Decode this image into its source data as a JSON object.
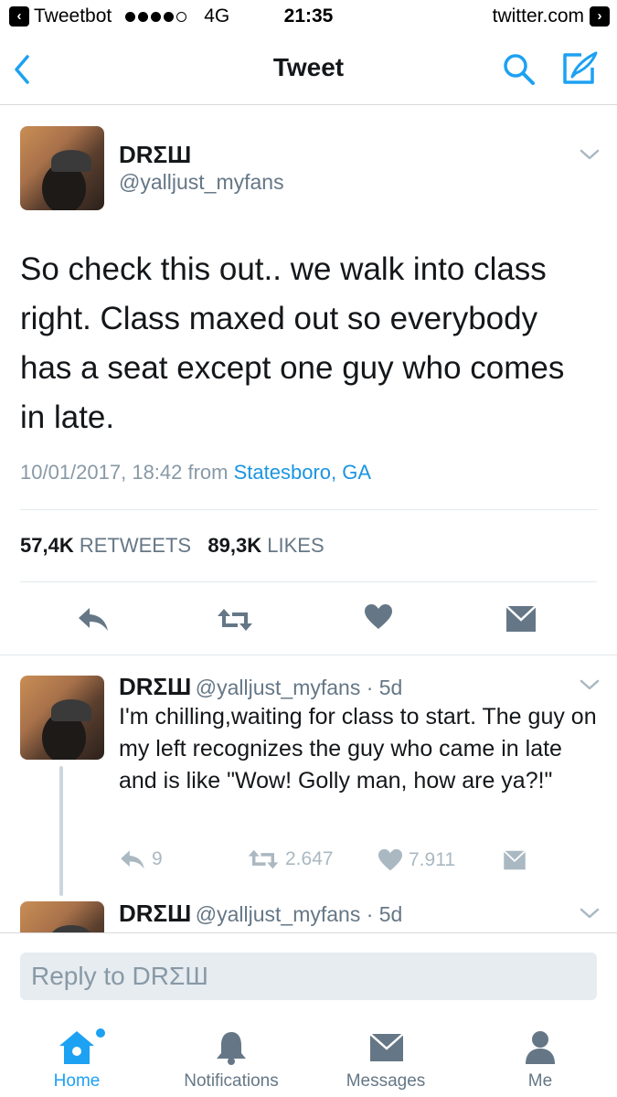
{
  "status_bar": {
    "back_app": "Tweetbot",
    "network": "4G",
    "time": "21:35",
    "url": "twitter.com"
  },
  "nav": {
    "title": "Tweet",
    "icons": [
      "back-chevron-icon",
      "search-icon",
      "compose-icon"
    ]
  },
  "tweet": {
    "display_name": "DRΣШ",
    "handle": "@yalljust_myfans",
    "text": "So check this out.. we walk into class right. Class maxed out so everybody has a seat except one guy who comes in late.",
    "timestamp": "10/01/2017, 18:42 from ",
    "location": "Statesboro, GA",
    "retweets_count": "57,4K",
    "retweets_label": "RETWEETS",
    "likes_count": "89,3K",
    "likes_label": "LIKES"
  },
  "replies": [
    {
      "display_name": "DRΣШ",
      "handle_time": "@yalljust_myfans · 5d",
      "text": "I'm chilling,waiting for class to start. The guy on my left recognizes the guy who came in late and is like \"Wow! Golly man, how are ya?!\"",
      "reply_count": "9",
      "retweet_count": "2.647",
      "like_count": "7.911"
    },
    {
      "display_name": "DRΣШ",
      "handle_time": "@yalljust_myfans · 5d"
    }
  ],
  "reply_box": {
    "placeholder": "Reply to DRΣШ"
  },
  "tabbar": {
    "tabs": [
      {
        "label": "Home",
        "icon": "home-icon"
      },
      {
        "label": "Notifications",
        "icon": "bell-icon"
      },
      {
        "label": "Messages",
        "icon": "envelope-icon"
      },
      {
        "label": "Me",
        "icon": "person-icon"
      }
    ]
  },
  "colors": {
    "accent": "#1da1f2",
    "text": "#14171a",
    "secondary": "#657786"
  }
}
